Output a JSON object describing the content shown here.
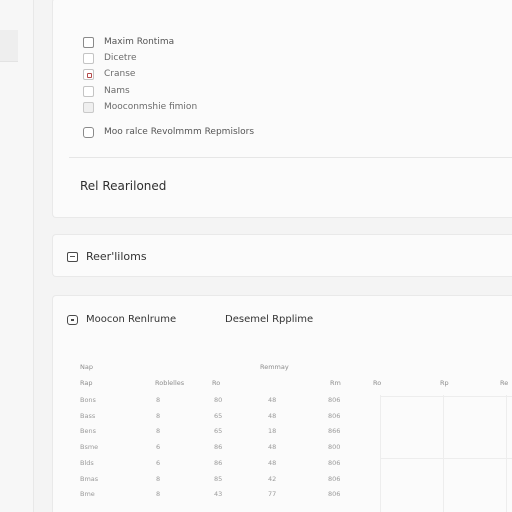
{
  "filters": {
    "options": [
      {
        "label": "Maxim Rontima",
        "checked": false,
        "style": "dark"
      },
      {
        "label": "Dicetre",
        "checked": false,
        "style": "light"
      },
      {
        "label": "Cranse",
        "checked": true,
        "style": "marked"
      },
      {
        "label": "Nams",
        "checked": false,
        "style": "light"
      },
      {
        "label": "Mooconmshie fimion",
        "checked": false,
        "style": "dim"
      }
    ],
    "extra_option": {
      "label": "Moo ralce Revolmmm Repmislors"
    },
    "section_title": "Rel Reariloned"
  },
  "relations": {
    "title": "Reer'liloms"
  },
  "results": {
    "title": "Moocon Renlrume",
    "subtitle": "Desemel Rpplime",
    "table": {
      "top_headers": [
        "Nap",
        "Remmay"
      ],
      "headers": [
        "Rap",
        "Roblelles",
        "Ro",
        "Rm",
        "Ro",
        "Rp",
        "Re"
      ],
      "rows": [
        [
          "Bons",
          "8",
          "80",
          "48",
          "806"
        ],
        [
          "Bass",
          "8",
          "65",
          "48",
          "806"
        ],
        [
          "Bens",
          "8",
          "65",
          "18",
          "866"
        ],
        [
          "Bsme",
          "6",
          "86",
          "48",
          "800"
        ],
        [
          "Blds",
          "6",
          "86",
          "48",
          "806"
        ],
        [
          "Bmas",
          "8",
          "85",
          "42",
          "806"
        ],
        [
          "Bme",
          "8",
          "43",
          "77",
          "806"
        ]
      ]
    }
  }
}
